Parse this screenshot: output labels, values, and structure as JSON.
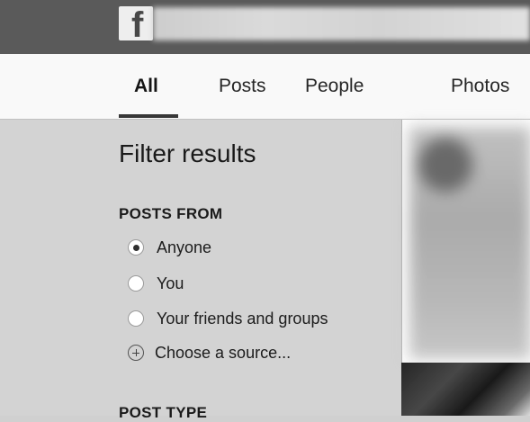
{
  "header": {
    "logo_letter": "f",
    "search_value": ""
  },
  "tabs": [
    {
      "label": "All",
      "active": true
    },
    {
      "label": "Posts",
      "active": false
    },
    {
      "label": "People",
      "active": false
    },
    {
      "label": "Photos",
      "active": false
    }
  ],
  "filter": {
    "title": "Filter results",
    "posts_from": {
      "heading": "POSTS FROM",
      "options": [
        {
          "label": "Anyone",
          "selected": true
        },
        {
          "label": "You",
          "selected": false
        },
        {
          "label": "Your friends and groups",
          "selected": false
        }
      ],
      "choose_source": "Choose a source..."
    },
    "post_type": {
      "heading": "POST TYPE"
    }
  },
  "colors": {
    "topbar": "#5c5c5c",
    "panel": "#cfcfcf",
    "tabbar": "#f3f3f3"
  },
  "icons": {
    "logo": "facebook-logo-icon",
    "radio": "radio-icon",
    "add": "plus-circle-icon"
  }
}
